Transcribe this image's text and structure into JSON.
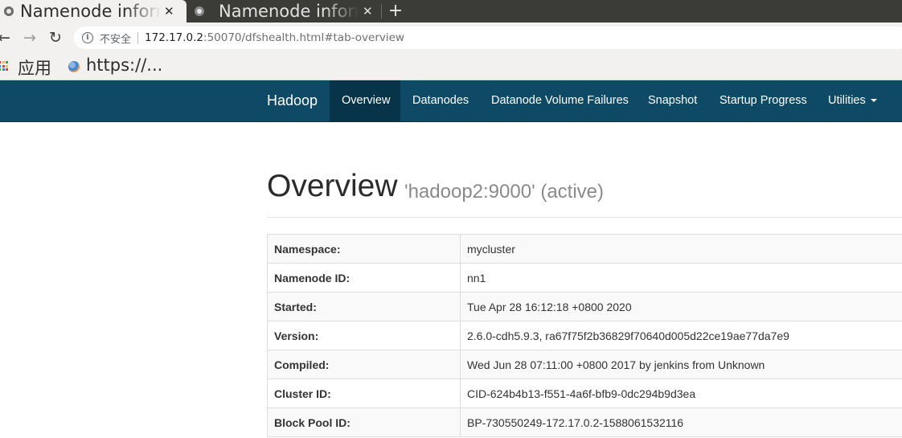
{
  "browser": {
    "tabs": [
      {
        "title": "Namenode information",
        "active": true
      },
      {
        "title": "Namenode information",
        "active": false
      }
    ],
    "address_bar": {
      "security_label": "不安全",
      "url_host": "172.17.0.2",
      "url_rest": ":50070/dfshealth.html#tab-overview"
    },
    "bookmarks": [
      {
        "label": "应用",
        "icon": "apps-grid-icon"
      },
      {
        "label": "https://...",
        "icon": "site-favicon-icon"
      }
    ]
  },
  "navbar": {
    "brand": "Hadoop",
    "items": [
      {
        "label": "Overview",
        "active": true
      },
      {
        "label": "Datanodes"
      },
      {
        "label": "Datanode Volume Failures"
      },
      {
        "label": "Snapshot"
      },
      {
        "label": "Startup Progress"
      },
      {
        "label": "Utilities",
        "dropdown": true
      }
    ]
  },
  "page": {
    "title": "Overview",
    "subtitle": "'hadoop2:9000' (active)"
  },
  "overview_table": [
    {
      "key": "Namespace:",
      "value": "mycluster"
    },
    {
      "key": "Namenode ID:",
      "value": "nn1"
    },
    {
      "key": "Started:",
      "value": "Tue Apr 28 16:12:18 +0800 2020"
    },
    {
      "key": "Version:",
      "value": "2.6.0-cdh5.9.3, ra67f75f2b36829f70640d005d22ce19ae77da7e9"
    },
    {
      "key": "Compiled:",
      "value": "Wed Jun 28 07:11:00 +0800 2017 by jenkins from Unknown"
    },
    {
      "key": "Cluster ID:",
      "value": "CID-624b4b13-f551-4a6f-bfb9-0dc294b9d3ea"
    },
    {
      "key": "Block Pool ID:",
      "value": "BP-730550249-172.17.0.2-1588061532116"
    }
  ],
  "colors": {
    "navbar_bg": "#0e4a66",
    "navbar_active_bg": "#08344a",
    "tabstrip_bg": "#3b3b37"
  }
}
